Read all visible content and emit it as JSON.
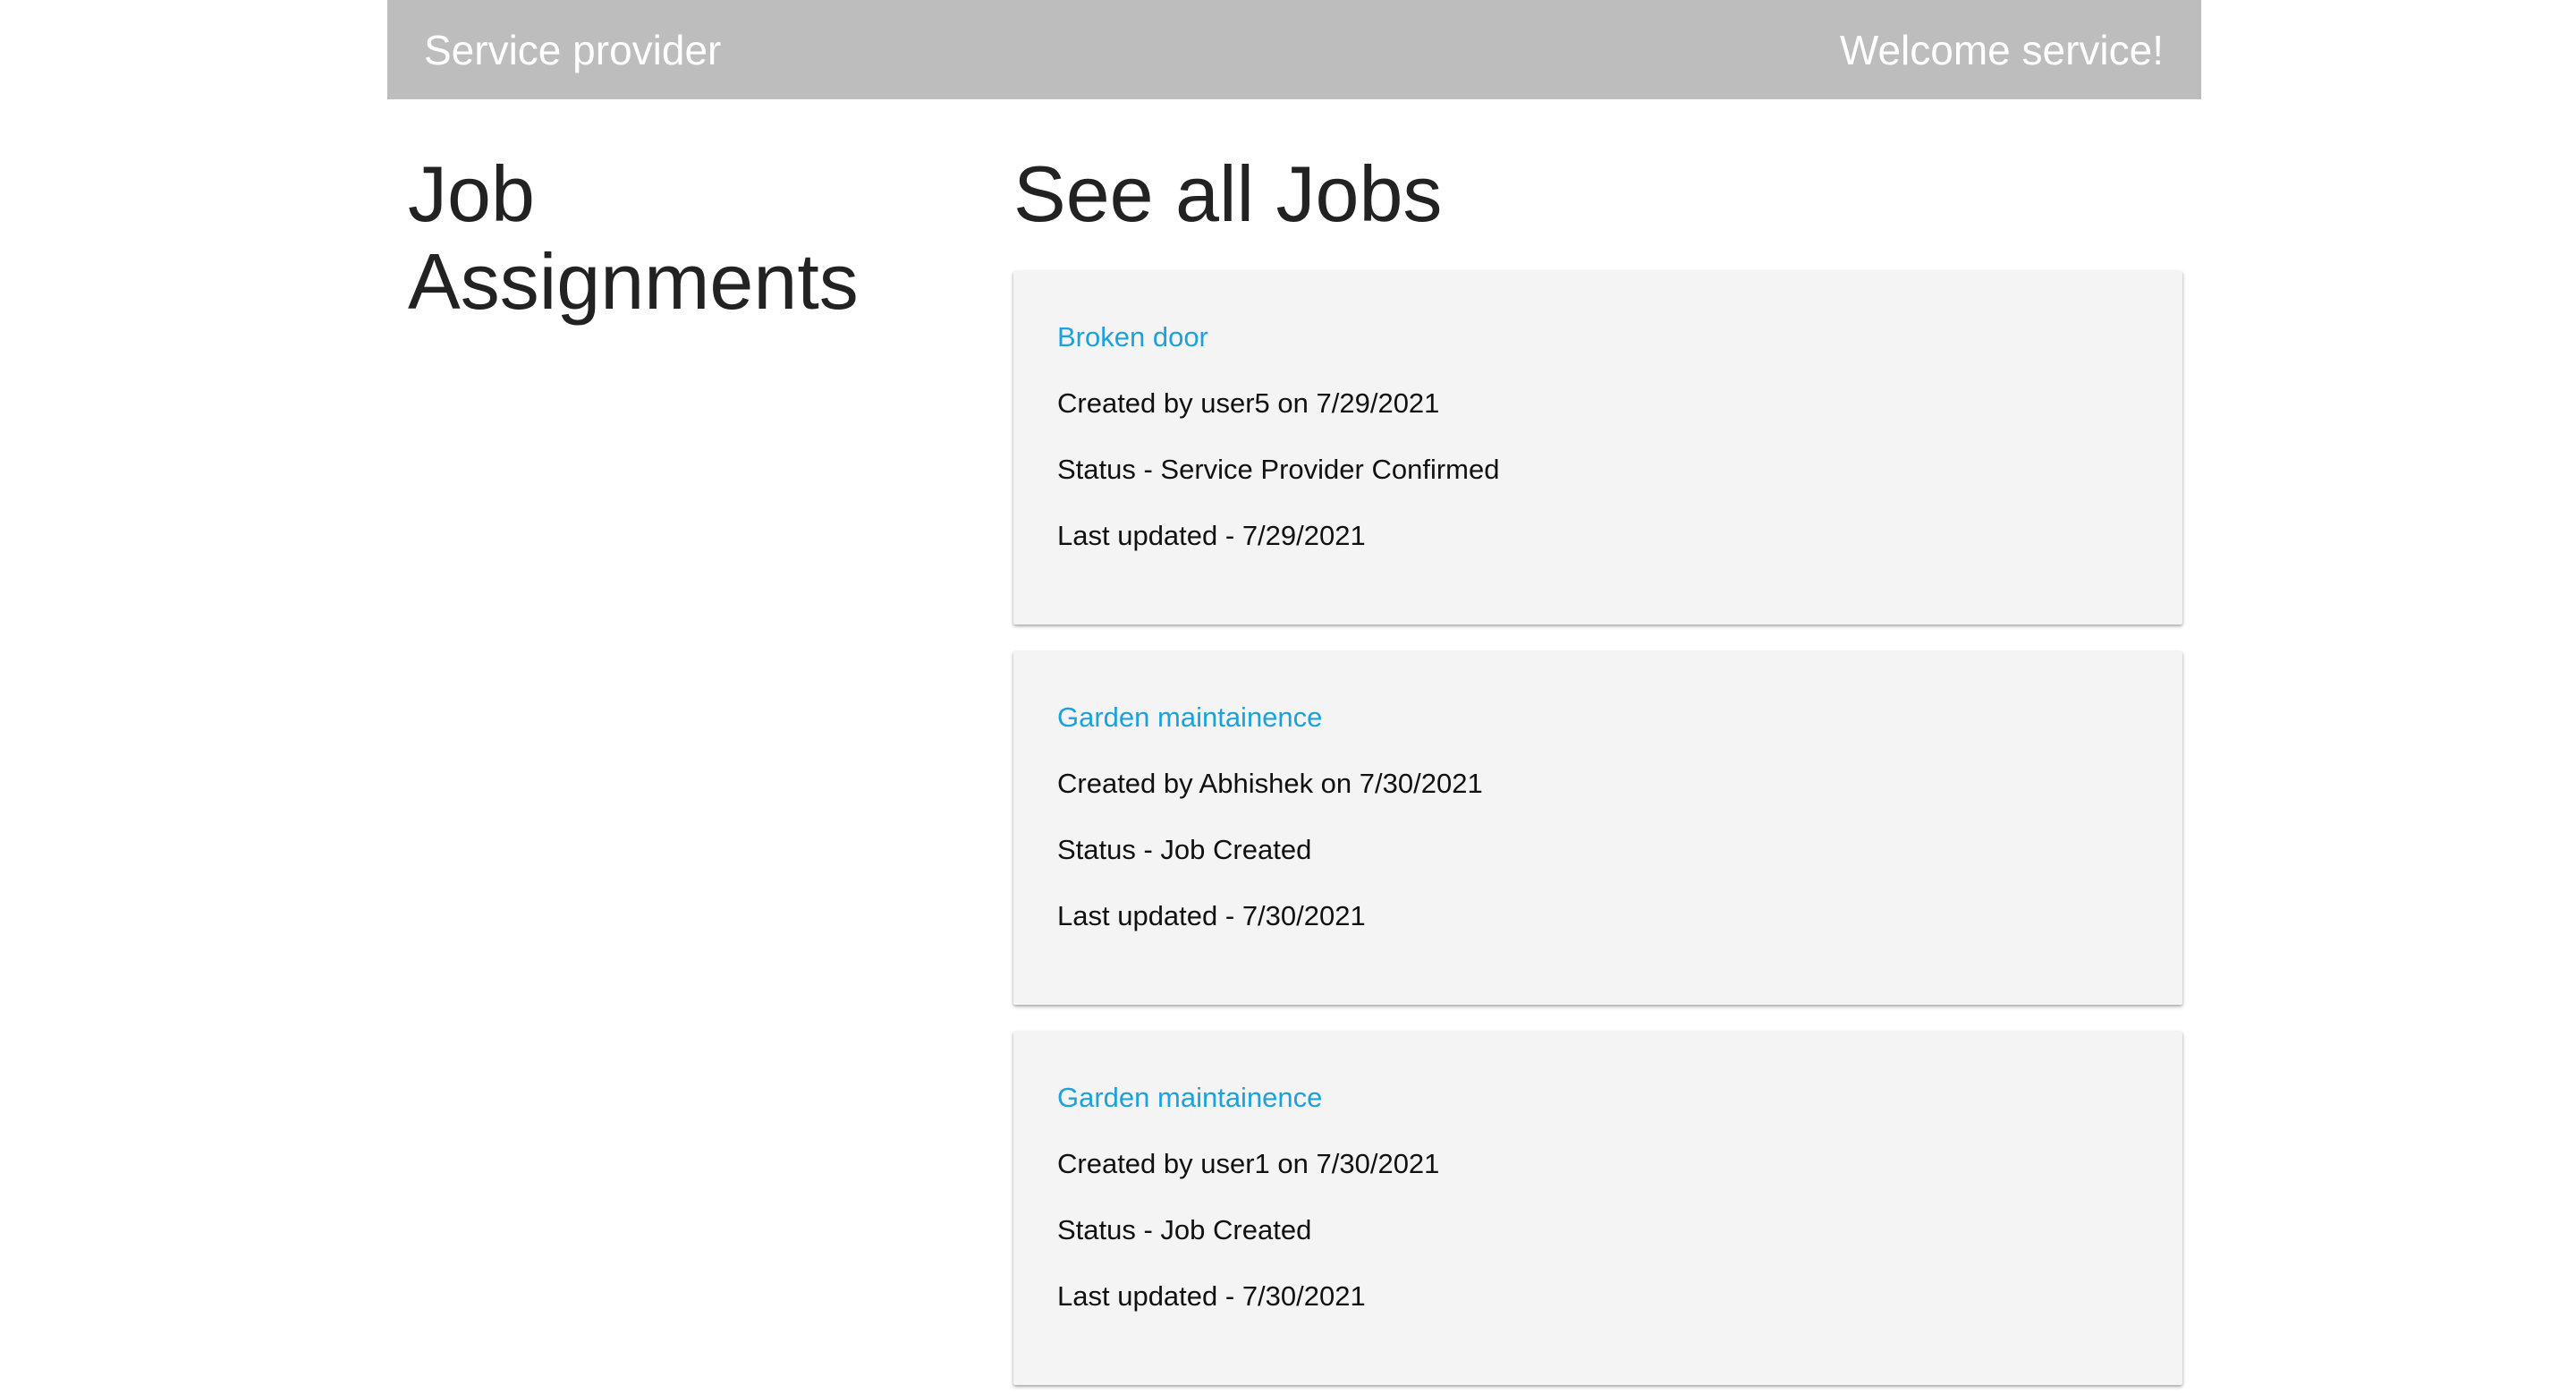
{
  "header": {
    "brand": "Service provider",
    "welcome": "Welcome service!"
  },
  "sidebar": {
    "title": "Job Assignments"
  },
  "main": {
    "title": "See all Jobs",
    "jobs": [
      {
        "title": "Broken door",
        "created": "Created by user5 on 7/29/2021",
        "status": "Status - Service Provider Confirmed",
        "updated": "Last updated - 7/29/2021"
      },
      {
        "title": "Garden maintainence",
        "created": "Created by Abhishek on 7/30/2021",
        "status": "Status - Job Created",
        "updated": "Last updated - 7/30/2021"
      },
      {
        "title": "Garden maintainence",
        "created": "Created by user1 on 7/30/2021",
        "status": "Status - Job Created",
        "updated": "Last updated - 7/30/2021"
      }
    ]
  },
  "colors": {
    "header_bg": "#bdbdbd",
    "card_bg": "#f4f4f4",
    "link": "#1da1db"
  }
}
